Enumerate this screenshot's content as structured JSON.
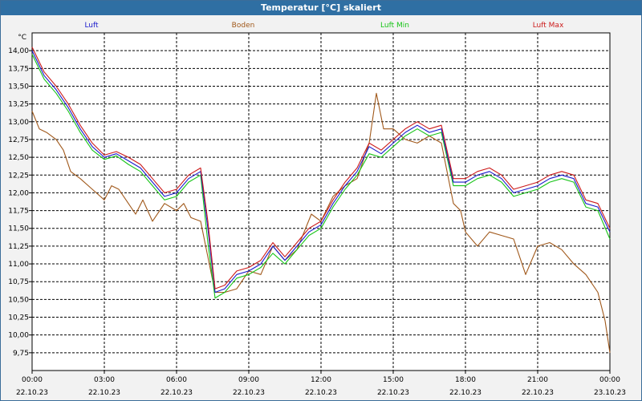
{
  "window": {
    "title": "Temperatur [°C] skaliert"
  },
  "chart_data": {
    "type": "line",
    "title": "Temperatur [°C] skaliert",
    "ylabel": "°C",
    "xlabel": "",
    "ylim": [
      9.5,
      14.25
    ],
    "xlim": [
      0,
      24
    ],
    "grid": true,
    "legend_position": "top",
    "y_ticks": [
      "14,00",
      "13,75",
      "13,50",
      "13,25",
      "13,00",
      "12,75",
      "12,50",
      "12,25",
      "12,00",
      "11,75",
      "11,50",
      "11,25",
      "11,00",
      "10,75",
      "10,50",
      "10,25",
      "10,00",
      "9,75"
    ],
    "x_tick_times": [
      "00:00",
      "03:00",
      "06:00",
      "09:00",
      "12:00",
      "15:00",
      "18:00",
      "21:00",
      "00:00"
    ],
    "x_tick_dates": [
      "22.10.23",
      "22.10.23",
      "22.10.23",
      "22.10.23",
      "22.10.23",
      "22.10.23",
      "22.10.23",
      "22.10.23",
      "23.10.23"
    ],
    "series": [
      {
        "name": "Luft",
        "color": "#1a1acc",
        "x": [
          0,
          0.5,
          1,
          1.5,
          2,
          2.5,
          3,
          3.5,
          4,
          4.5,
          5,
          5.5,
          6,
          6.5,
          7,
          7.3,
          7.6,
          8,
          8.5,
          9,
          9.5,
          10,
          10.5,
          11,
          11.5,
          12,
          12.5,
          13,
          13.5,
          14,
          14.5,
          15,
          15.5,
          16,
          16.5,
          17,
          17.5,
          18,
          18.5,
          19,
          19.5,
          20,
          20.5,
          21,
          21.5,
          22,
          22.5,
          23,
          23.5,
          24
        ],
        "values": [
          14.0,
          13.65,
          13.45,
          13.2,
          12.9,
          12.65,
          12.5,
          12.55,
          12.45,
          12.35,
          12.15,
          11.95,
          12.0,
          12.2,
          12.3,
          11.5,
          10.6,
          10.65,
          10.85,
          10.9,
          11.0,
          11.25,
          11.05,
          11.25,
          11.45,
          11.55,
          11.85,
          12.1,
          12.3,
          12.65,
          12.55,
          12.7,
          12.85,
          12.95,
          12.85,
          12.9,
          12.15,
          12.15,
          12.25,
          12.3,
          12.2,
          12.0,
          12.05,
          12.1,
          12.2,
          12.25,
          12.2,
          11.85,
          11.8,
          11.45
        ]
      },
      {
        "name": "Boden",
        "color": "#a0581a",
        "x": [
          0,
          0.3,
          0.6,
          1,
          1.3,
          1.6,
          2,
          2.5,
          3,
          3.3,
          3.6,
          4,
          4.3,
          4.6,
          5,
          5.5,
          6,
          6.3,
          6.6,
          7,
          7.3,
          7.6,
          8,
          8.5,
          9,
          9.5,
          10,
          10.5,
          11,
          11.3,
          11.6,
          12,
          12.5,
          13,
          13.5,
          14,
          14.3,
          14.6,
          15,
          15.5,
          16,
          16.5,
          17,
          17.5,
          17.8,
          18,
          18.5,
          19,
          19.5,
          20,
          20.5,
          21,
          21.5,
          22,
          22.5,
          23,
          23.5,
          23.8,
          24
        ],
        "values": [
          13.15,
          12.9,
          12.85,
          12.75,
          12.6,
          12.3,
          12.2,
          12.05,
          11.9,
          12.1,
          12.05,
          11.85,
          11.7,
          11.9,
          11.6,
          11.85,
          11.75,
          11.85,
          11.65,
          11.6,
          11.1,
          10.6,
          10.6,
          10.65,
          10.9,
          10.85,
          11.25,
          11.05,
          11.2,
          11.45,
          11.7,
          11.6,
          11.95,
          12.1,
          12.2,
          12.7,
          13.4,
          12.9,
          12.9,
          12.75,
          12.7,
          12.8,
          12.7,
          11.85,
          11.75,
          11.45,
          11.25,
          11.45,
          11.4,
          11.35,
          10.85,
          11.25,
          11.3,
          11.2,
          11.0,
          10.85,
          10.6,
          10.2,
          9.75
        ]
      },
      {
        "name": "Luft Min",
        "color": "#17c417",
        "x": [
          0,
          0.5,
          1,
          1.5,
          2,
          2.5,
          3,
          3.5,
          4,
          4.5,
          5,
          5.5,
          6,
          6.5,
          7,
          7.3,
          7.6,
          8,
          8.5,
          9,
          9.5,
          10,
          10.5,
          11,
          11.5,
          12,
          12.5,
          13,
          13.5,
          14,
          14.5,
          15,
          15.5,
          16,
          16.5,
          17,
          17.5,
          18,
          18.5,
          19,
          19.5,
          20,
          20.5,
          21,
          21.5,
          22,
          22.5,
          23,
          23.5,
          24
        ],
        "values": [
          13.95,
          13.6,
          13.4,
          13.15,
          12.85,
          12.6,
          12.47,
          12.52,
          12.4,
          12.3,
          12.1,
          11.9,
          11.95,
          12.15,
          12.25,
          11.3,
          10.52,
          10.6,
          10.8,
          10.85,
          10.95,
          11.15,
          11.0,
          11.2,
          11.4,
          11.5,
          11.8,
          12.05,
          12.25,
          12.55,
          12.5,
          12.65,
          12.8,
          12.9,
          12.8,
          12.85,
          12.1,
          12.1,
          12.2,
          12.25,
          12.15,
          11.95,
          12.0,
          12.05,
          12.15,
          12.2,
          12.15,
          11.8,
          11.75,
          11.35
        ]
      },
      {
        "name": "Luft Max",
        "color": "#cc1a1a",
        "x": [
          0,
          0.5,
          1,
          1.5,
          2,
          2.5,
          3,
          3.5,
          4,
          4.5,
          5,
          5.5,
          6,
          6.5,
          7,
          7.3,
          7.6,
          8,
          8.5,
          9,
          9.5,
          10,
          10.5,
          11,
          11.5,
          12,
          12.5,
          13,
          13.5,
          14,
          14.5,
          15,
          15.5,
          16,
          16.5,
          17,
          17.5,
          18,
          18.5,
          19,
          19.5,
          20,
          20.5,
          21,
          21.5,
          22,
          22.5,
          23,
          23.5,
          24
        ],
        "values": [
          14.05,
          13.7,
          13.5,
          13.25,
          12.95,
          12.7,
          12.53,
          12.58,
          12.5,
          12.4,
          12.2,
          12.0,
          12.05,
          12.25,
          12.35,
          11.6,
          10.65,
          10.7,
          10.9,
          10.95,
          11.05,
          11.3,
          11.1,
          11.3,
          11.5,
          11.6,
          11.9,
          12.15,
          12.35,
          12.7,
          12.6,
          12.75,
          12.9,
          13.0,
          12.9,
          12.95,
          12.2,
          12.2,
          12.3,
          12.35,
          12.25,
          12.05,
          12.1,
          12.15,
          12.25,
          12.3,
          12.25,
          11.9,
          11.85,
          11.5
        ]
      }
    ]
  }
}
